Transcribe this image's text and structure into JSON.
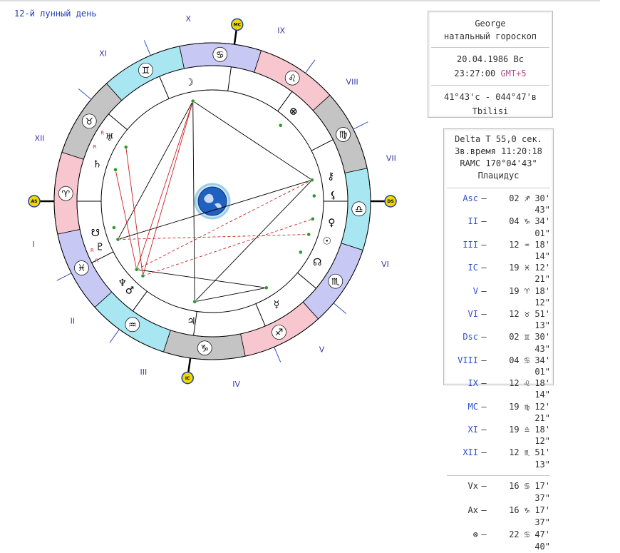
{
  "lunar_day": "12-й лунный день",
  "chart": {
    "sign_glyphs": [
      "♈",
      "♉",
      "♊",
      "♋",
      "♌",
      "♍",
      "♎",
      "♏",
      "♐",
      "♑",
      "♒",
      "♓"
    ],
    "house_labels": [
      "I",
      "II",
      "III",
      "IV",
      "V",
      "VI",
      "VII",
      "VIII",
      "IX",
      "X",
      "XI",
      "XII"
    ],
    "axis_labels": {
      "asc": "AS",
      "dsc": "DS",
      "mc": "MC",
      "ic": "IC"
    },
    "planets": [
      {
        "name": "moon",
        "glyph": "☽"
      },
      {
        "name": "chiron",
        "glyph": "⚷"
      },
      {
        "name": "lilith",
        "glyph": "⚸"
      },
      {
        "name": "venus",
        "glyph": "♀"
      },
      {
        "name": "sun",
        "glyph": "☉"
      },
      {
        "name": "north-node",
        "glyph": "☊"
      },
      {
        "name": "mercury",
        "glyph": "☿"
      },
      {
        "name": "jupiter",
        "glyph": "♃"
      },
      {
        "name": "mars",
        "glyph": "♂"
      },
      {
        "name": "neptune",
        "glyph": "♆"
      },
      {
        "name": "pluto",
        "glyph": "♇"
      },
      {
        "name": "saturn",
        "glyph": "♄"
      },
      {
        "name": "uranus",
        "glyph": "♅"
      },
      {
        "name": "south-node",
        "glyph": "☋"
      },
      {
        "name": "fortune",
        "glyph": "⊗"
      }
    ],
    "retro_mark": "R"
  },
  "info": {
    "name": "George",
    "chart_type": "натальный гороскоп",
    "date": "20.04.1986 Вс",
    "time": "23:27:00",
    "gmt": "GMT+5",
    "coords": "41°43'с - 044°47'в",
    "city": "Tbilisi"
  },
  "details": {
    "delta_t": "Delta T  55,0 сек.",
    "sidereal": "Зв.время 11:20:18",
    "ramc": "RAMC 170°04'43\"",
    "system": "Плацидус"
  },
  "houses": [
    {
      "name": "Asc",
      "value": "02 ♐ 30' 43\""
    },
    {
      "name": "II",
      "value": "04 ♑ 34' 01\""
    },
    {
      "name": "III",
      "value": "12 ♒ 18' 14\""
    },
    {
      "name": "IC",
      "value": "19 ♓ 12' 21\""
    },
    {
      "name": "V",
      "value": "19 ♈ 18' 12\""
    },
    {
      "name": "VI",
      "value": "12 ♉ 51' 13\""
    },
    {
      "name": "Dsc",
      "value": "02 ♊ 30' 43\""
    },
    {
      "name": "VIII",
      "value": "04 ♋ 34' 01\""
    },
    {
      "name": "IX",
      "value": "12 ♌ 18' 14\""
    },
    {
      "name": "MC",
      "value": "19 ♍ 12' 21\""
    },
    {
      "name": "XI",
      "value": "19 ♎ 18' 12\""
    },
    {
      "name": "XII",
      "value": "12 ♏ 51' 13\""
    }
  ],
  "points": [
    {
      "name": "Vx",
      "value": "16 ♋ 17' 37\""
    },
    {
      "name": "Ax",
      "value": "16 ♑ 17' 37\""
    },
    {
      "name": "⊗",
      "value": "22 ♋ 47' 40\""
    }
  ],
  "dash": "–",
  "colors": {
    "fire": "#f7c6ce",
    "earth": "#c4c4c4",
    "air": "#a8e6f2",
    "water": "#c8c8f4",
    "house_label": "#3a3aa0",
    "aspect_red": "#cc2020",
    "aspect_black": "#000000",
    "axis_marker": "#f0d800"
  }
}
